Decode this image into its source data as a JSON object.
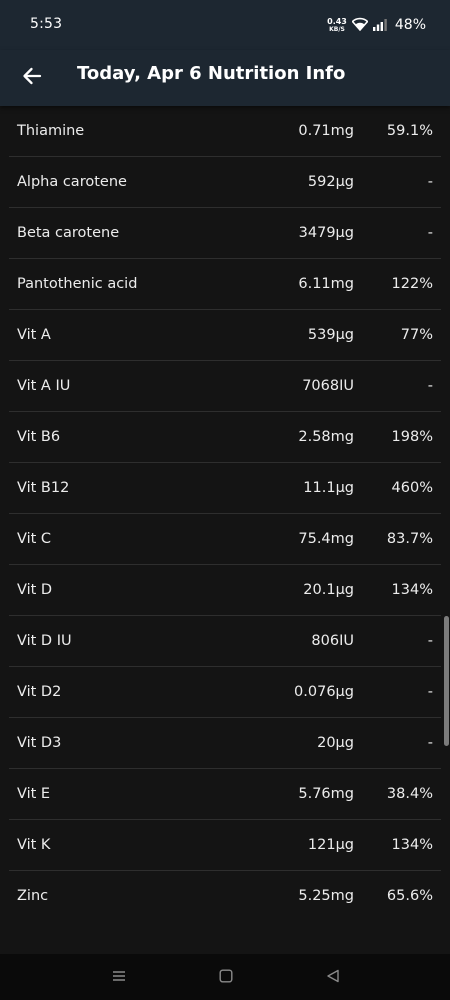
{
  "status_bar": {
    "time": "5:53",
    "net_speed": "0.43",
    "net_unit": "KB/S",
    "battery": "48%"
  },
  "app_bar": {
    "back_icon": "arrow-left-icon",
    "title": "Today, Apr 6 Nutrition Info"
  },
  "nutrients": [
    {
      "name": "Thiamine",
      "amount": "0.71mg",
      "percent": "59.1%"
    },
    {
      "name": "Alpha carotene",
      "amount": "592µg",
      "percent": "-"
    },
    {
      "name": "Beta carotene",
      "amount": "3479µg",
      "percent": "-"
    },
    {
      "name": "Pantothenic acid",
      "amount": "6.11mg",
      "percent": "122%"
    },
    {
      "name": "Vit A",
      "amount": "539µg",
      "percent": "77%"
    },
    {
      "name": "Vit A IU",
      "amount": "7068IU",
      "percent": "-"
    },
    {
      "name": "Vit B6",
      "amount": "2.58mg",
      "percent": "198%"
    },
    {
      "name": "Vit B12",
      "amount": "11.1µg",
      "percent": "460%"
    },
    {
      "name": "Vit C",
      "amount": "75.4mg",
      "percent": "83.7%"
    },
    {
      "name": "Vit D",
      "amount": "20.1µg",
      "percent": "134%"
    },
    {
      "name": "Vit D IU",
      "amount": "806IU",
      "percent": "-"
    },
    {
      "name": "Vit D2",
      "amount": "0.076µg",
      "percent": "-"
    },
    {
      "name": "Vit D3",
      "amount": "20µg",
      "percent": "-"
    },
    {
      "name": "Vit E",
      "amount": "5.76mg",
      "percent": "38.4%"
    },
    {
      "name": "Vit K",
      "amount": "121µg",
      "percent": "134%"
    },
    {
      "name": "Zinc",
      "amount": "5.25mg",
      "percent": "65.6%"
    }
  ],
  "nav_bar": {
    "icons": [
      "menu-icon",
      "home-icon",
      "back-triangle-icon"
    ]
  },
  "colors": {
    "header_bg": "#1d2731",
    "content_bg": "#141414",
    "divider": "#2e2e2e",
    "nav_bg": "#0a0a0a"
  }
}
